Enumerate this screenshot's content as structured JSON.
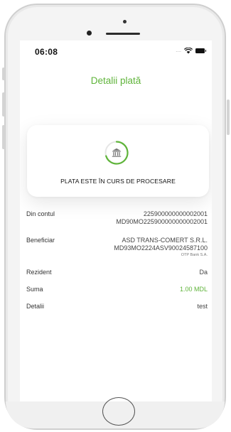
{
  "status": {
    "time": "06:08",
    "signal": "...."
  },
  "header": {
    "title": "Detalii plată"
  },
  "card": {
    "message": "PLATA ESTE ÎN CURS DE PROCESARE",
    "icon": "bank-icon",
    "ring_color": "#5fb43a"
  },
  "details": {
    "from_account": {
      "label": "Din contul",
      "line1": "225900000000002001",
      "line2": "MD90MO225900000000002001"
    },
    "beneficiary": {
      "label": "Beneficiar",
      "name": "ASD TRANS-COMERT S.R.L.",
      "iban": "MD93MO2224ASV90024587100",
      "bank": "OTP Bank S.A."
    },
    "resident": {
      "label": "Rezident",
      "value": "Da"
    },
    "amount": {
      "label": "Suma",
      "value": "1.00 MDL"
    },
    "details": {
      "label": "Detalii",
      "value": "test"
    }
  },
  "colors": {
    "accent": "#5fb43a"
  }
}
